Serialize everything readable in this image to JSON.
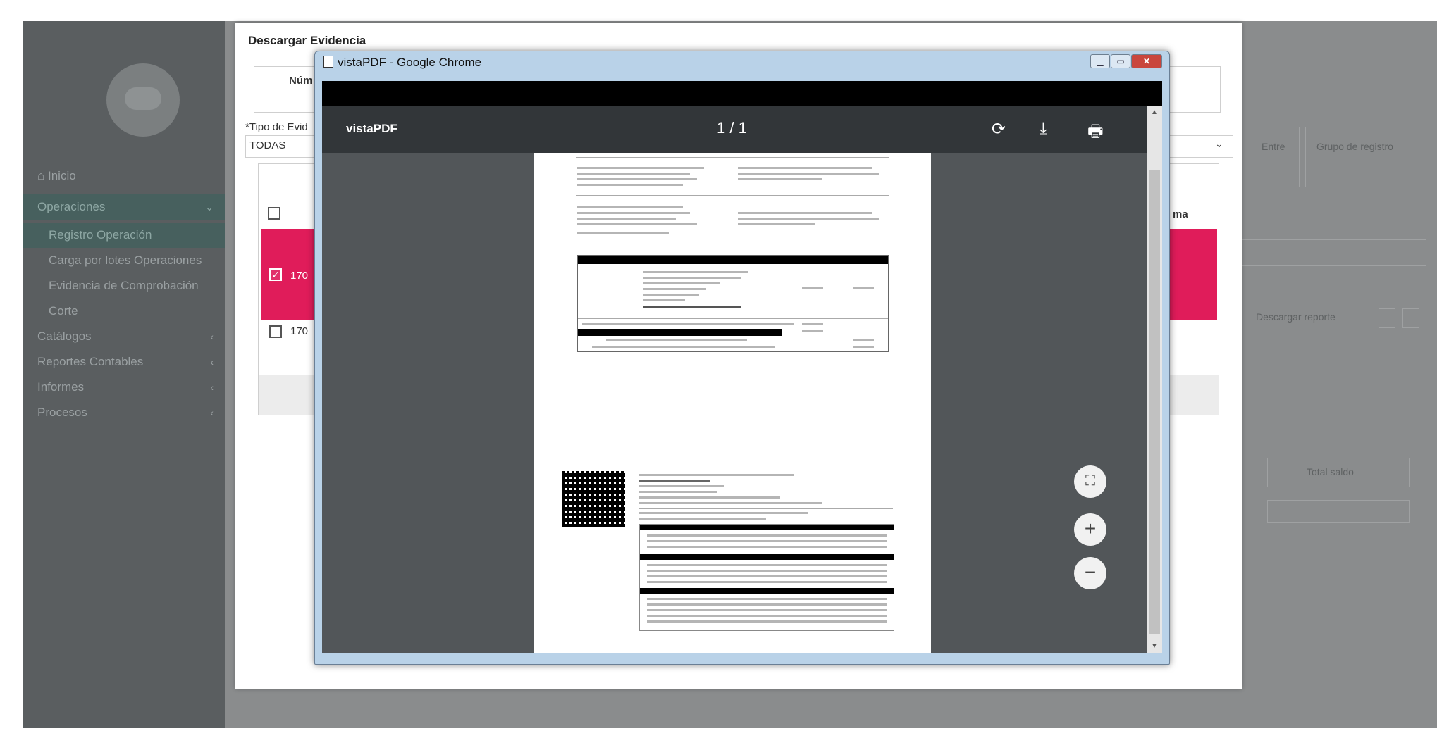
{
  "sidebar": {
    "items": [
      {
        "label": "Inicio",
        "icon": "home-icon"
      },
      {
        "label": "Operaciones",
        "chevron": "⌄"
      },
      {
        "label": "Registro Operación"
      },
      {
        "label": "Carga por lotes Operaciones"
      },
      {
        "label": "Evidencia de Comprobación"
      },
      {
        "label": "Corte"
      },
      {
        "label": "Catálogos",
        "chevron": "‹"
      },
      {
        "label": "Reportes Contables",
        "chevron": "‹"
      },
      {
        "label": "Informes",
        "chevron": "‹"
      },
      {
        "label": "Procesos",
        "chevron": "‹"
      }
    ]
  },
  "right_panel": {
    "header1": "Entre",
    "header2": "Grupo de registro",
    "action_label": "Descargar reporte",
    "total_label": "Total saldo"
  },
  "dialog": {
    "title": "Descargar Evidencia",
    "column_label": "Núm",
    "filter_label": "*Tipo de Evid",
    "filter_value": "TODAS",
    "row1_code": "170",
    "row2_code": "170",
    "right_col_fragment": "ma"
  },
  "chrome_window": {
    "title": "vistaPDF - Google Chrome",
    "pdf_name": "vistaPDF",
    "page_indicator": "1 / 1",
    "rotate_icon": "⟳",
    "download_icon": "⤓",
    "print_icon": "🖶",
    "fit_icon": "⛶",
    "zoom_in": "+",
    "zoom_out": "−"
  }
}
